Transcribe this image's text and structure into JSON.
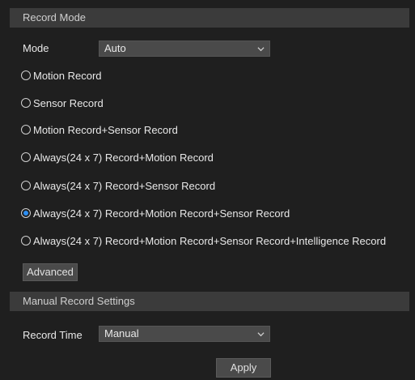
{
  "record_mode": {
    "header": "Record Mode",
    "mode_label": "Mode",
    "mode_value": "Auto",
    "options": [
      {
        "label": "Motion Record",
        "checked": false
      },
      {
        "label": "Sensor Record",
        "checked": false
      },
      {
        "label": "Motion Record+Sensor Record",
        "checked": false
      },
      {
        "label": "Always(24 x 7) Record+Motion Record",
        "checked": false
      },
      {
        "label": "Always(24 x 7) Record+Sensor Record",
        "checked": false
      },
      {
        "label": "Always(24 x 7) Record+Motion Record+Sensor Record",
        "checked": true
      },
      {
        "label": "Always(24 x 7) Record+Motion Record+Sensor Record+Intelligence Record",
        "checked": false
      }
    ],
    "advanced_label": "Advanced"
  },
  "manual_record": {
    "header": "Manual Record Settings",
    "record_time_label": "Record Time",
    "record_time_value": "Manual",
    "apply_label": "Apply"
  },
  "colors": {
    "background": "#1f1f1f",
    "header_bg": "#3b3b3b",
    "control_bg": "#4a4a4a",
    "accent": "#2c8ef2"
  }
}
